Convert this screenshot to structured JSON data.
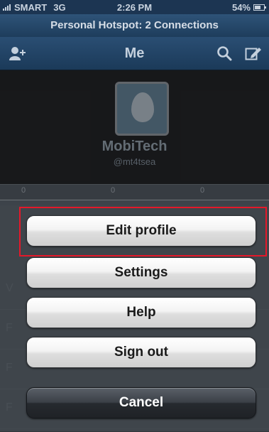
{
  "status_bar": {
    "carrier": "SMART",
    "network": "3G",
    "time": "2:26 PM",
    "battery": "54%",
    "battery_level": 0.54
  },
  "hotspot": {
    "text": "Personal Hotspot: 2 Connections"
  },
  "nav": {
    "title": "Me",
    "icons": [
      "add-user-icon",
      "search-icon",
      "compose-icon"
    ]
  },
  "profile": {
    "display_name": "MobiTech",
    "handle": "@mt4tsea",
    "stats": [
      "0",
      "0",
      "0"
    ]
  },
  "background_list": {
    "items": [
      "V",
      "F",
      "F",
      "F"
    ]
  },
  "action_sheet": {
    "buttons": [
      "Edit profile",
      "Settings",
      "Help",
      "Sign out"
    ],
    "cancel": "Cancel"
  },
  "colors": {
    "nav_bar": "#1e3d5c",
    "highlight": "#e5182a",
    "cancel_button": "#2b2f34"
  }
}
